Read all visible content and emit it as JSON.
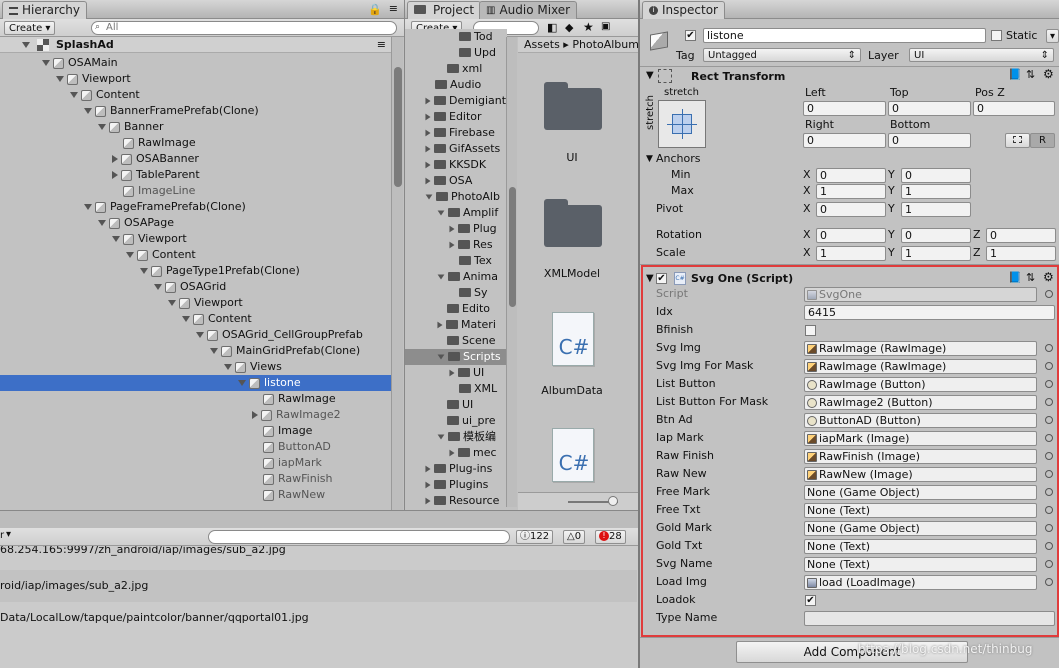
{
  "hierarchy": {
    "tab": "Hierarchy",
    "create": "Create",
    "search_placeholder": "All",
    "scene": "SplashAd",
    "rows": [
      {
        "d": 4,
        "t": "OSAMain",
        "e": "down"
      },
      {
        "d": 5,
        "t": "Viewport",
        "e": "down"
      },
      {
        "d": 6,
        "t": "Content",
        "e": "down"
      },
      {
        "d": 7,
        "t": "BannerFramePrefab(Clone)",
        "e": "down"
      },
      {
        "d": 8,
        "t": "Banner",
        "e": "down"
      },
      {
        "d": 9,
        "t": "RawImage",
        "e": ""
      },
      {
        "d": 9,
        "t": "OSABanner",
        "e": "right"
      },
      {
        "d": 9,
        "t": "TableParent",
        "e": "right"
      },
      {
        "d": 9,
        "t": "ImageLine",
        "e": "",
        "g": 1
      },
      {
        "d": 7,
        "t": "PageFramePrefab(Clone)",
        "e": "down"
      },
      {
        "d": 8,
        "t": "OSAPage",
        "e": "down"
      },
      {
        "d": 9,
        "t": "Viewport",
        "e": "down"
      },
      {
        "d": 10,
        "t": "Content",
        "e": "down"
      },
      {
        "d": 11,
        "t": "PageType1Prefab(Clone)",
        "e": "down"
      },
      {
        "d": 12,
        "t": "OSAGrid",
        "e": "down"
      },
      {
        "d": 13,
        "t": "Viewport",
        "e": "down"
      },
      {
        "d": 14,
        "t": "Content",
        "e": "down"
      },
      {
        "d": 15,
        "t": "OSAGrid_CellGroupPrefab",
        "e": "down"
      },
      {
        "d": 16,
        "t": "MainGridPrefab(Clone)",
        "e": "down"
      },
      {
        "d": 17,
        "t": "Views",
        "e": "down"
      },
      {
        "d": 18,
        "t": "listone",
        "e": "down",
        "s": 1
      },
      {
        "d": 19,
        "t": "RawImage",
        "e": ""
      },
      {
        "d": 19,
        "t": "RawImage2",
        "e": "right",
        "g": 1
      },
      {
        "d": 19,
        "t": "Image",
        "e": ""
      },
      {
        "d": 19,
        "t": "ButtonAD",
        "e": "",
        "g": 1
      },
      {
        "d": 19,
        "t": "iapMark",
        "e": "",
        "g": 1
      },
      {
        "d": 19,
        "t": "RawFinish",
        "e": "",
        "g": 1
      },
      {
        "d": 19,
        "t": "RawNew",
        "e": "",
        "g": 1
      }
    ]
  },
  "project": {
    "tab": "Project",
    "tab2": "Audio Mixer",
    "create": "Create",
    "breadcrumb": [
      "Assets",
      "PhotoAlbum"
    ],
    "tree": [
      {
        "d": 3,
        "t": "Tod"
      },
      {
        "d": 3,
        "t": "Upd"
      },
      {
        "d": 2,
        "t": "xml"
      },
      {
        "d": 1,
        "t": "Audio"
      },
      {
        "d": 1,
        "t": "Demigiant",
        "e": "right"
      },
      {
        "d": 1,
        "t": "Editor",
        "e": "right"
      },
      {
        "d": 1,
        "t": "Firebase",
        "e": "right"
      },
      {
        "d": 1,
        "t": "GifAssets",
        "e": "right"
      },
      {
        "d": 1,
        "t": "KKSDK",
        "e": "right"
      },
      {
        "d": 1,
        "t": "OSA",
        "e": "right"
      },
      {
        "d": 1,
        "t": "PhotoAlb",
        "e": "down"
      },
      {
        "d": 2,
        "t": "Amplif",
        "e": "down"
      },
      {
        "d": 3,
        "t": "Plug",
        "e": "right"
      },
      {
        "d": 3,
        "t": "Res",
        "e": "right"
      },
      {
        "d": 3,
        "t": "Tex"
      },
      {
        "d": 2,
        "t": "Anima",
        "e": "down"
      },
      {
        "d": 3,
        "t": "Sy"
      },
      {
        "d": 2,
        "t": "Edito"
      },
      {
        "d": 2,
        "t": "Materi",
        "e": "right"
      },
      {
        "d": 2,
        "t": "Scene"
      },
      {
        "d": 2,
        "t": "Scripts",
        "e": "down",
        "s": 1
      },
      {
        "d": 3,
        "t": "UI",
        "e": "right"
      },
      {
        "d": 3,
        "t": "XML"
      },
      {
        "d": 2,
        "t": "UI"
      },
      {
        "d": 2,
        "t": "ui_pre"
      },
      {
        "d": 2,
        "t": "模板编",
        "e": "down"
      },
      {
        "d": 3,
        "t": "mec",
        "e": "right"
      },
      {
        "d": 1,
        "t": "Plug-ins",
        "e": "right"
      },
      {
        "d": 1,
        "t": "Plugins",
        "e": "right"
      },
      {
        "d": 1,
        "t": "Resource",
        "e": "right"
      }
    ],
    "assets": [
      {
        "name": "UI",
        "kind": "folder"
      },
      {
        "name": "XMLModel",
        "kind": "folder"
      },
      {
        "name": "AlbumData",
        "kind": "cs"
      },
      {
        "name": "",
        "kind": "cs"
      }
    ],
    "cs_label": "C#"
  },
  "inspector": {
    "tab": "Inspector",
    "name": "listone",
    "static_label": "Static",
    "tag_label": "Tag",
    "tag": "Untagged",
    "layer_label": "Layer",
    "layer": "UI",
    "rect": {
      "title": "Rect Transform",
      "stretch": "stretch",
      "stretch_v": "stretch",
      "left_l": "Left",
      "top_l": "Top",
      "posz_l": "Pos Z",
      "left": "0",
      "top": "0",
      "posz": "0",
      "right_l": "Right",
      "bottom_l": "Bottom",
      "right": "0",
      "bottom": "0",
      "r_btn": "R",
      "anchors_l": "Anchors",
      "min_l": "Min",
      "max_l": "Max",
      "pivot_l": "Pivot",
      "rotation_l": "Rotation",
      "scale_l": "Scale",
      "min": [
        "0",
        "0"
      ],
      "max": [
        "1",
        "1"
      ],
      "pivot": [
        "0",
        "1"
      ],
      "rotation": [
        "0",
        "0",
        "0"
      ],
      "scale": [
        "1",
        "1",
        "1"
      ],
      "x": "X",
      "y": "Y",
      "z": "Z"
    },
    "script": {
      "title": "Svg One (Script)",
      "cs_tag": "C#",
      "fields": [
        {
          "l": "Script",
          "v": "SvgOne",
          "k": "script"
        },
        {
          "l": "Idx",
          "v": "6415",
          "k": "text"
        },
        {
          "l": "Bfinish",
          "v": "",
          "k": "check"
        },
        {
          "l": "Svg Img",
          "v": "RawImage (RawImage)",
          "k": "img"
        },
        {
          "l": "Svg Img For Mask",
          "v": "RawImage (RawImage)",
          "k": "img"
        },
        {
          "l": "List Button",
          "v": "RawImage (Button)",
          "k": "btn"
        },
        {
          "l": "List Button For Mask",
          "v": "RawImage2 (Button)",
          "k": "btn"
        },
        {
          "l": "Btn Ad",
          "v": "ButtonAD (Button)",
          "k": "btn"
        },
        {
          "l": "Iap Mark",
          "v": "iapMark (Image)",
          "k": "img"
        },
        {
          "l": "Raw Finish",
          "v": "RawFinish (Image)",
          "k": "img"
        },
        {
          "l": "Raw New",
          "v": "RawNew (Image)",
          "k": "img"
        },
        {
          "l": "Free Mark",
          "v": "None (Game Object)",
          "k": "none"
        },
        {
          "l": "Free Txt",
          "v": "None (Text)",
          "k": "none"
        },
        {
          "l": "Gold Mark",
          "v": "None (Game Object)",
          "k": "none"
        },
        {
          "l": "Gold Txt",
          "v": "None (Text)",
          "k": "none"
        },
        {
          "l": "Svg Name",
          "v": "None (Text)",
          "k": "none"
        },
        {
          "l": "Load Img",
          "v": "load (LoadImage)",
          "k": "load"
        },
        {
          "l": "Loadok",
          "v": "✔",
          "k": "checked"
        },
        {
          "l": "Type Name",
          "v": "",
          "k": "text"
        }
      ]
    },
    "add_component": "Add Component"
  },
  "console": {
    "counts": {
      "log": "122",
      "warn": "0",
      "error": "28"
    },
    "left_label": "r",
    "rows": [
      "68.254.165:9997/zh_android/iap/images/sub_a2.jpg",
      "roid/iap/images/sub_a2.jpg",
      "Data/LocalLow/tapque/paintcolor/banner/qqportal01.jpg"
    ]
  },
  "watermark": "https://blog.csdn.net/thinbug"
}
